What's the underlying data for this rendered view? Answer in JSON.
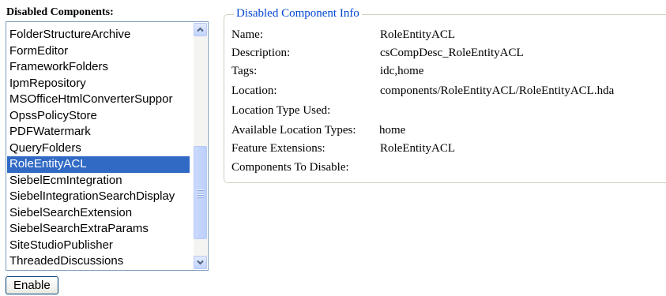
{
  "left": {
    "heading": "Disabled Components:",
    "items": [
      "FolderStructureArchive",
      "FormEditor",
      "FrameworkFolders",
      "IpmRepository",
      "MSOfficeHtmlConverterSuppor",
      "OpssPolicyStore",
      "PDFWatermark",
      "QueryFolders",
      "RoleEntityACL",
      "SiebelEcmIntegration",
      "SiebelIntegrationSearchDisplay",
      "SiebelSearchExtension",
      "SiebelSearchExtraParams",
      "SiteStudioPublisher",
      "ThreadedDiscussions"
    ],
    "selected_item": "RoleEntityACL",
    "enable_label": "Enable"
  },
  "info": {
    "legend": "Disabled Component Info",
    "rows": [
      {
        "label": "Name:",
        "value": "RoleEntityACL"
      },
      {
        "label": "Description:",
        "value": "csCompDesc_RoleEntityACL"
      },
      {
        "label": "Tags:",
        "value": "idc,home"
      },
      {
        "label": "Location:",
        "value": "components/RoleEntityACL/RoleEntityACL.hda"
      },
      {
        "label": "Location Type Used:",
        "value": ""
      },
      {
        "label": "Available Location Types:",
        "value": "home"
      },
      {
        "label": "Feature Extensions:",
        "value": "RoleEntityACL"
      },
      {
        "label": "Components To Disable:",
        "value": ""
      }
    ]
  },
  "colors": {
    "selection": "#316ac5",
    "legend_text": "#0046d5",
    "list_border": "#7f9db9"
  }
}
